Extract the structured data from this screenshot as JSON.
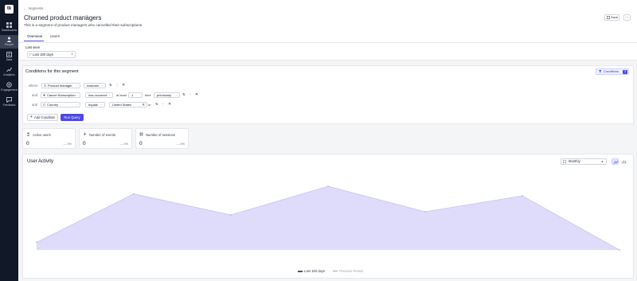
{
  "sidebar": {
    "logo": "tk",
    "items": [
      {
        "label": "Dashboards",
        "icon": "grid-icon"
      },
      {
        "label": "People",
        "icon": "people-icon"
      },
      {
        "label": "Data",
        "icon": "data-icon"
      },
      {
        "label": "Analytics",
        "icon": "analytics-icon"
      },
      {
        "label": "Engagement",
        "icon": "engagement-icon"
      },
      {
        "label": "Feedback",
        "icon": "feedback-icon"
      }
    ]
  },
  "header": {
    "breadcrumb": "Segments",
    "title": "Churned product managers",
    "description": "This is  a segment of product managers who cancelled their subscriptions",
    "save_label": "Save",
    "more_label": "⋯",
    "tabs": [
      {
        "label": "Overview",
        "active": true
      },
      {
        "label": "Users",
        "active": false
      }
    ]
  },
  "filters": {
    "last_seen_label": "Last seen",
    "last_seen_value": "Last 180 days"
  },
  "conditions": {
    "title": "Conditions for this segment",
    "badge_label": "Conditions",
    "badge_count": "3",
    "rows": [
      {
        "prefix": "where",
        "property": "Product manager",
        "operator": "matches"
      },
      {
        "prefix": "and",
        "property": "Cancel Subscription",
        "operator": "has occurred",
        "qualifier": "at least",
        "count": "1",
        "unit": "time",
        "period": "previously"
      },
      {
        "prefix": "and",
        "property": "Country",
        "operator": "equals",
        "value": "United States",
        "joiner": "or"
      }
    ],
    "add_label": "Add Condition",
    "run_label": "Run Query"
  },
  "stats": [
    {
      "label": "Active users",
      "value": "0",
      "change": "— 0%"
    },
    {
      "label": "Number of events",
      "value": "0",
      "change": "— 0%"
    },
    {
      "label": "Number of sessions",
      "value": "0",
      "change": "— 0%"
    }
  ],
  "activity": {
    "title": "User Activity",
    "period": "Monthly",
    "legend": [
      {
        "name": "Last 180 days",
        "color": "#4b5563"
      },
      {
        "name": "Previous Period",
        "color": "#9ca3af"
      }
    ]
  },
  "chart_data": {
    "type": "area",
    "x": [
      1,
      2,
      3,
      4,
      5,
      6,
      7
    ],
    "series": [
      {
        "name": "Last 180 days",
        "values": [
          12,
          88,
          55,
          100,
          60,
          85,
          0
        ],
        "color": "#c7c4f2"
      }
    ],
    "ylim": [
      0,
      100
    ],
    "grid": false
  },
  "colors": {
    "accent": "#4f46e5",
    "sidebar": "#111827",
    "area_fill": "#dedcfa"
  }
}
